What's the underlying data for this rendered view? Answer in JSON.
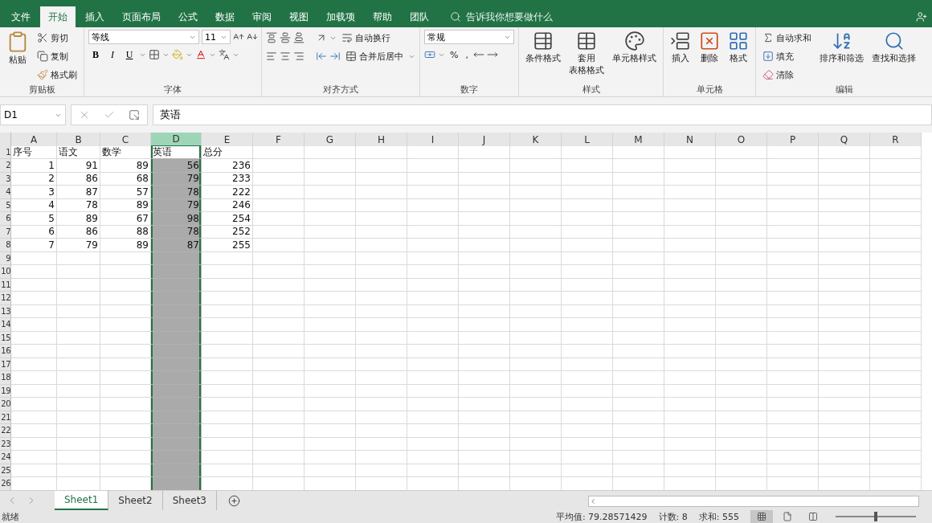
{
  "tabs": [
    {
      "label": "文件",
      "selected": false
    },
    {
      "label": "开始",
      "selected": true
    },
    {
      "label": "插入",
      "selected": false
    },
    {
      "label": "页面布局",
      "selected": false
    },
    {
      "label": "公式",
      "selected": false
    },
    {
      "label": "数据",
      "selected": false
    },
    {
      "label": "审阅",
      "selected": false
    },
    {
      "label": "视图",
      "selected": false
    },
    {
      "label": "加载项",
      "selected": false
    },
    {
      "label": "帮助",
      "selected": false
    },
    {
      "label": "团队",
      "selected": false
    }
  ],
  "tell_me": {
    "placeholder": "告诉我你想要做什么"
  },
  "clipboard": {
    "paste": "粘贴",
    "cut": "剪切",
    "copy": "复制",
    "format_painter": "格式刷",
    "label": "剪贴板"
  },
  "font": {
    "name": "等线",
    "size": "11",
    "bold": "B",
    "italic": "I",
    "underline": "U",
    "label": "字体"
  },
  "alignment": {
    "wrap": "自动换行",
    "merge": "合并后居中",
    "label": "对齐方式"
  },
  "number": {
    "format": "常规",
    "percent": "%",
    "comma": ",",
    "label": "数字"
  },
  "styles": {
    "items": [
      {
        "lines": [
          "条件格式"
        ]
      },
      {
        "lines": [
          "套用",
          "表格格式"
        ]
      },
      {
        "lines": [
          "单元格样式"
        ]
      }
    ],
    "label": "样式"
  },
  "cells": {
    "items": [
      "插入",
      "删除",
      "格式"
    ],
    "label": "单元格"
  },
  "editing": {
    "autosum": "自动求和",
    "fill": "填充",
    "clear": "清除",
    "sort": "排序和筛选",
    "find": "查找和选择",
    "label": "编辑"
  },
  "name_box": "D1",
  "formula": "英语",
  "columns": [
    {
      "label": "A",
      "selected": false
    },
    {
      "label": "B",
      "selected": false
    },
    {
      "label": "C",
      "selected": false
    },
    {
      "label": "D",
      "selected": true
    },
    {
      "label": "E",
      "selected": false
    },
    {
      "label": "F",
      "selected": false
    },
    {
      "label": "G",
      "selected": false
    },
    {
      "label": "H",
      "selected": false
    },
    {
      "label": "I",
      "selected": false
    },
    {
      "label": "J",
      "selected": false
    },
    {
      "label": "K",
      "selected": false
    },
    {
      "label": "L",
      "selected": false
    },
    {
      "label": "M",
      "selected": false
    },
    {
      "label": "N",
      "selected": false
    },
    {
      "label": "O",
      "selected": false
    },
    {
      "label": "P",
      "selected": false
    },
    {
      "label": "Q",
      "selected": false
    },
    {
      "label": "R",
      "selected": false
    }
  ],
  "row_headers": [
    "1",
    "2",
    "3",
    "4",
    "5",
    "6",
    "7",
    "8",
    "9",
    "10",
    "11",
    "12",
    "13",
    "14",
    "15",
    "16",
    "17",
    "18",
    "19",
    "20",
    "21",
    "22",
    "23",
    "24",
    "25",
    "26"
  ],
  "rows": [
    {
      "kind": "text",
      "cells": [
        "序号",
        "语文",
        "数学",
        "英语",
        "总分"
      ]
    },
    {
      "kind": "number",
      "cells": [
        "1",
        "91",
        "89",
        "56",
        "236"
      ]
    },
    {
      "kind": "number",
      "cells": [
        "2",
        "86",
        "68",
        "79",
        "233"
      ]
    },
    {
      "kind": "number",
      "cells": [
        "3",
        "87",
        "57",
        "78",
        "222"
      ]
    },
    {
      "kind": "number",
      "cells": [
        "4",
        "78",
        "89",
        "79",
        "246"
      ]
    },
    {
      "kind": "number",
      "cells": [
        "5",
        "89",
        "67",
        "98",
        "254"
      ]
    },
    {
      "kind": "number",
      "cells": [
        "6",
        "86",
        "88",
        "78",
        "252"
      ]
    },
    {
      "kind": "number",
      "cells": [
        "7",
        "79",
        "89",
        "87",
        "255"
      ]
    }
  ],
  "sheets": [
    {
      "label": "Sheet1",
      "selected": true
    },
    {
      "label": "Sheet2",
      "selected": false
    },
    {
      "label": "Sheet3",
      "selected": false
    }
  ],
  "zoom": {
    "level": 0.5
  },
  "status": {
    "ready": "就绪",
    "average": "平均值: 79.28571429",
    "count": "计数: 8",
    "sum": "求和: 555"
  }
}
